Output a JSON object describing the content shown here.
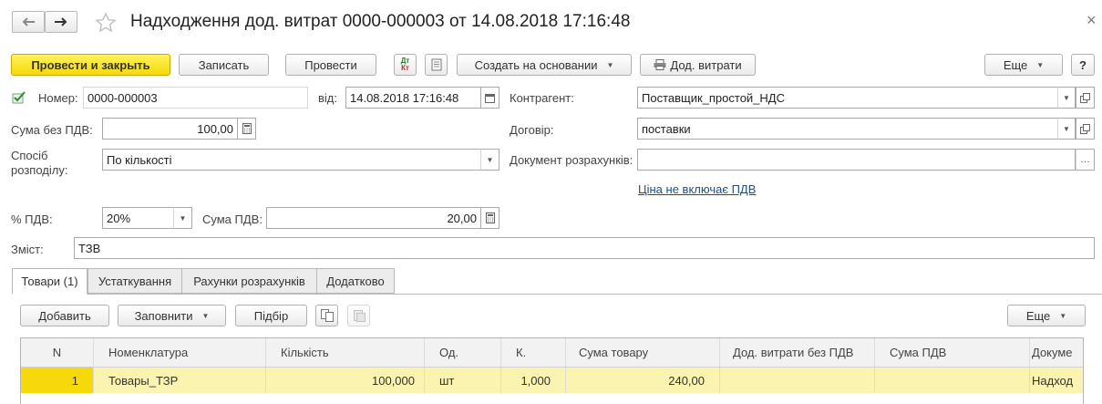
{
  "header": {
    "title": "Надходження дод. витрат 0000-000003 от 14.08.2018 17:16:48"
  },
  "toolbar": {
    "post_close": "Провести и закрыть",
    "save": "Записать",
    "post": "Провести",
    "dt_kt_icon_text": "Дт Кт",
    "create_based": "Создать на основании",
    "extra_costs": "Дод. витрати",
    "more": "Еще",
    "help": "?"
  },
  "form": {
    "number_label": "Номер:",
    "number_value": "0000-000003",
    "date_label": "від:",
    "date_value": "14.08.2018 17:16:48",
    "counterparty_label": "Контрагент:",
    "counterparty_value": "Поставщик_простой_НДС",
    "sum_no_vat_label": "Сума без ПДВ:",
    "sum_no_vat_value": "100,00",
    "contract_label": "Договір:",
    "contract_value": "поставки",
    "method_label_1": "Спосіб",
    "method_label_2": "розподілу:",
    "method_value": "По кількості",
    "settlement_doc_label": "Документ розрахунків:",
    "settlement_doc_value": "",
    "price_link": "Ціна не включає ПДВ",
    "vat_rate_label": "% ПДВ:",
    "vat_rate_value": "20%",
    "vat_sum_label": "Сума ПДВ:",
    "vat_sum_value": "20,00",
    "content_label": "Зміст:",
    "content_value": "ТЗВ"
  },
  "tabs": [
    {
      "label": "Товари (1)",
      "active": true
    },
    {
      "label": "Устаткування",
      "active": false
    },
    {
      "label": "Рахунки розрахунків",
      "active": false
    },
    {
      "label": "Додатково",
      "active": false
    }
  ],
  "table_toolbar": {
    "add": "Добавить",
    "fill": "Заповнити",
    "pick": "Підбір",
    "more": "Еще"
  },
  "table": {
    "columns": [
      "N",
      "Номенклатура",
      "Кількість",
      "Од.",
      "К.",
      "Сума товару",
      "Дод. витрати без ПДВ",
      "Сума ПДВ",
      "Докуме"
    ],
    "rows": [
      [
        "1",
        "Товары_ТЗР",
        "100,000",
        "шт",
        "1,000",
        "240,00",
        "",
        "",
        "Надход"
      ]
    ]
  },
  "colors": {
    "primary_button": "#f5d90a",
    "selected_row": "#fbf3b0",
    "link": "#1a4f8a"
  }
}
